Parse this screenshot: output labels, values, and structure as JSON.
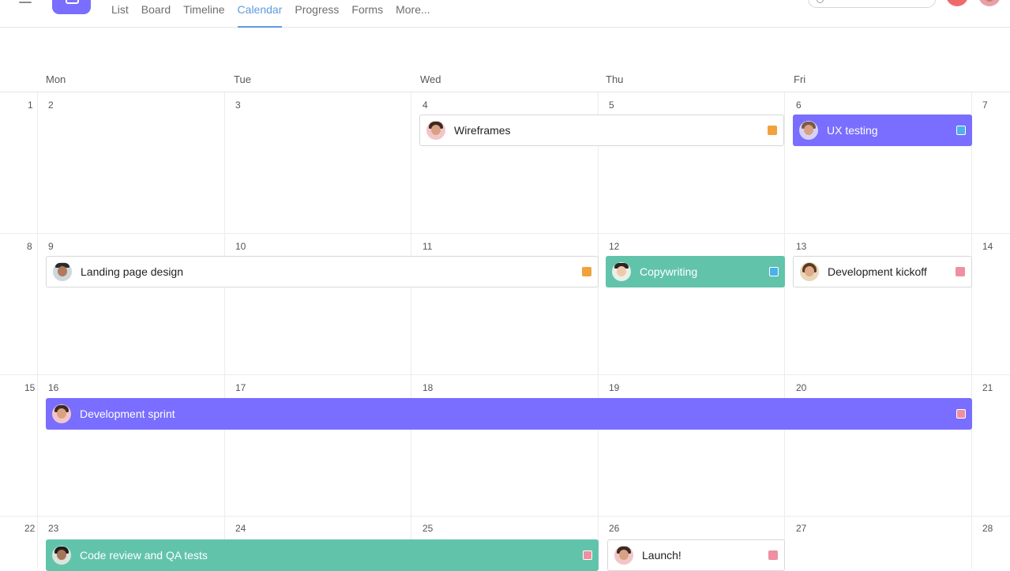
{
  "nav": {
    "tabs": [
      "List",
      "Board",
      "Timeline",
      "Calendar",
      "Progress",
      "Forms",
      "More..."
    ],
    "active_tab": "Calendar"
  },
  "calendar": {
    "day_names": [
      "Mon",
      "Tue",
      "Wed",
      "Thu",
      "Fri"
    ],
    "weeks": [
      [
        "1",
        "2",
        "3",
        "4",
        "5",
        "6",
        "7"
      ],
      [
        "8",
        "9",
        "10",
        "11",
        "12",
        "13",
        "14"
      ],
      [
        "15",
        "16",
        "17",
        "18",
        "19",
        "20",
        "21"
      ],
      [
        "22",
        "23",
        "24",
        "25",
        "26",
        "27",
        "28"
      ]
    ],
    "events": [
      {
        "title": "Wireframes",
        "style": "white",
        "tag_color": "#f1a23b"
      },
      {
        "title": "UX testing",
        "style": "purple",
        "tag_color": "#4ab1ec"
      },
      {
        "title": "Landing page design",
        "style": "white",
        "tag_color": "#f1a23b"
      },
      {
        "title": "Copywriting",
        "style": "teal",
        "tag_color": "#4ab1ec"
      },
      {
        "title": "Development kickoff",
        "style": "white",
        "tag_color": "#ef8fa2"
      },
      {
        "title": "Development sprint",
        "style": "purple",
        "tag_color": "#ef8fa2"
      },
      {
        "title": "Code review and QA tests",
        "style": "teal",
        "tag_color": "#ef8fa2"
      },
      {
        "title": "Launch!",
        "style": "white",
        "tag_color": "#ef8fa2"
      }
    ]
  },
  "colors": {
    "accent": "#5d9bdf",
    "purple": "#796eff",
    "teal": "#62c3ab"
  }
}
